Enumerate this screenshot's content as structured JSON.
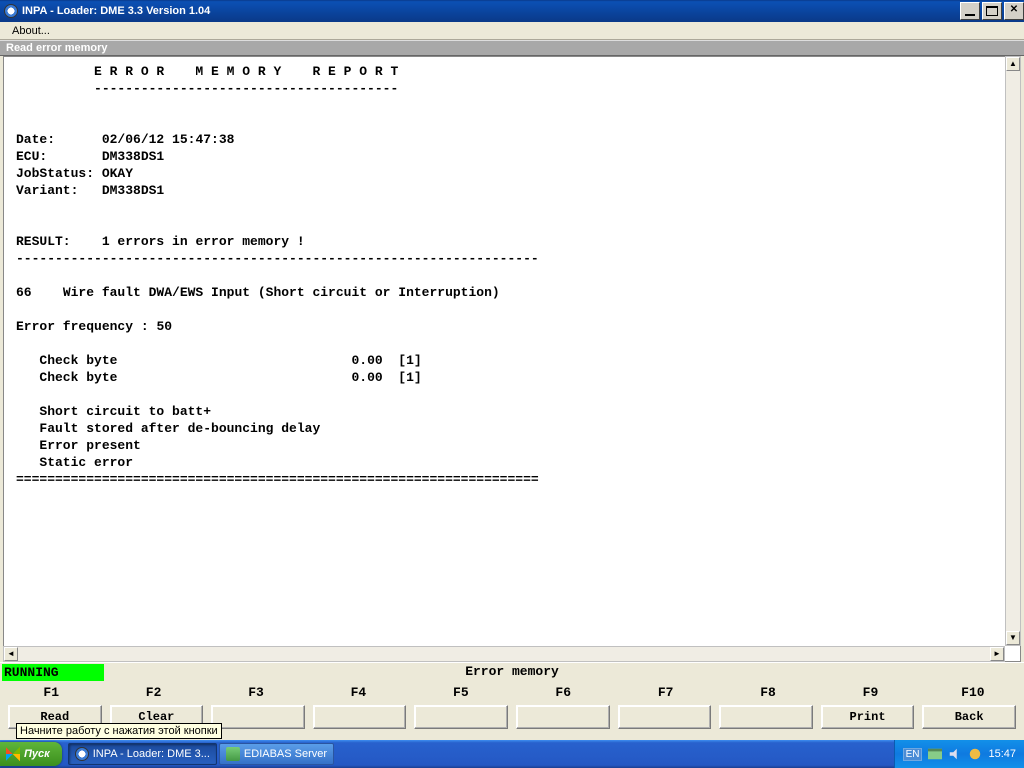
{
  "window": {
    "title": "INPA - Loader:  DME 3.3 Version 1.04"
  },
  "menu": {
    "about": "About..."
  },
  "subheader": "Read error memory",
  "report": {
    "header_title": "          E R R O R    M E M O R Y    R E P O R T",
    "header_underline": "          ---------------------------------------",
    "date_label": "Date:      ",
    "date_value": "02/06/12 15:47:38",
    "ecu_label": "ECU:       ",
    "ecu_value": "DM338DS1",
    "jobstatus_label": "JobStatus: ",
    "jobstatus_value": "OKAY",
    "variant_label": "Variant:   ",
    "variant_value": "DM338DS1",
    "result_label": "RESULT:    ",
    "result_value": "1 errors in error memory !",
    "divider": "-------------------------------------------------------------------",
    "fault_code": "66    ",
    "fault_text": "Wire fault DWA/EWS Input (Short circuit or Interruption)",
    "freq_label": "Error frequency : ",
    "freq_value": "50",
    "cb1_label": "   Check byte                              ",
    "cb1_val": "0.00  [1]",
    "cb2_label": "   Check byte                              ",
    "cb2_val": "0.00  [1]",
    "detail1": "   Short circuit to batt+",
    "detail2": "   Fault stored after de-bouncing delay",
    "detail3": "   Error present",
    "detail4": "   Static error",
    "end_divider": "==================================================================="
  },
  "footer": {
    "running": "RUNNING",
    "title": "Error memory",
    "keys": [
      "F1",
      "F2",
      "F3",
      "F4",
      "F5",
      "F6",
      "F7",
      "F8",
      "F9",
      "F10"
    ],
    "buttons": [
      "Read",
      "Clear",
      "",
      "",
      "",
      "",
      "",
      "",
      "Print",
      "Back"
    ]
  },
  "tooltip": "Начните работу с нажатия этой кнопки",
  "taskbar": {
    "start": "Пуск",
    "items": [
      "INPA - Loader:  DME 3...",
      "EDIABAS Server"
    ],
    "lang": "EN",
    "clock": "15:47"
  }
}
